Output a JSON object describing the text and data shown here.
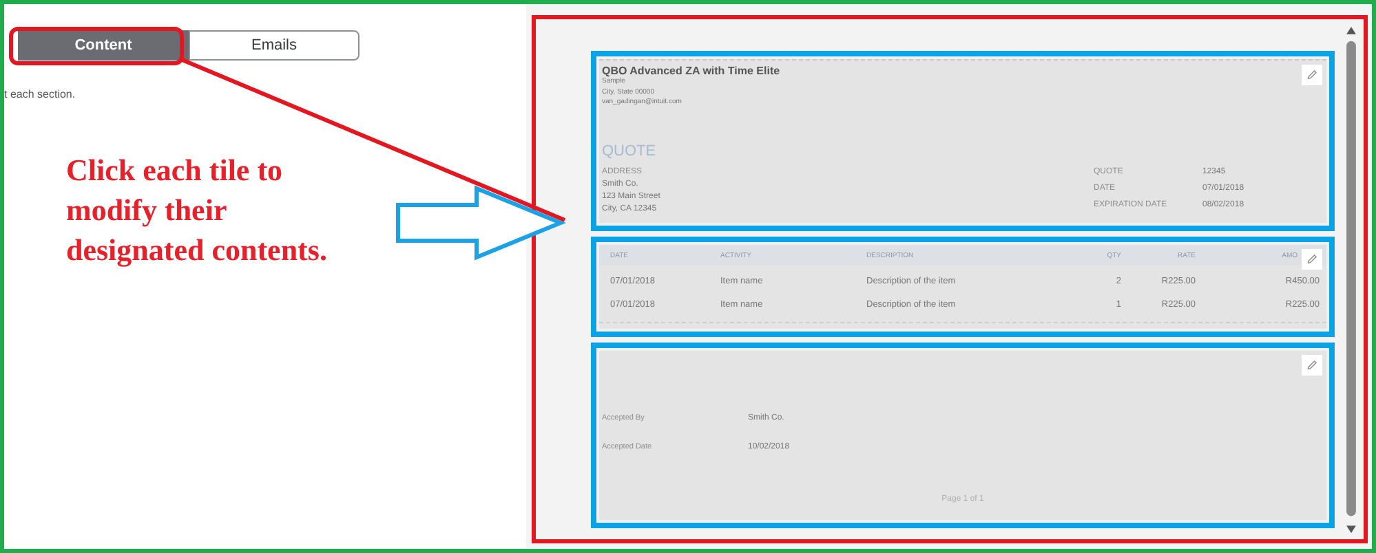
{
  "tabs": [
    {
      "label": "Content",
      "selected": true
    },
    {
      "label": "Emails",
      "selected": false
    }
  ],
  "hint": "t each section.",
  "annotation": "Click each tile to modify their designated contents.",
  "preview": {
    "header_tile": {
      "company": "QBO Advanced ZA with Time Elite",
      "address_lines": [
        "Sample",
        "City, State 00000",
        "van_gadingan@intuit.com"
      ],
      "doc_title": "QUOTE",
      "bill_to": {
        "label": "ADDRESS",
        "lines": [
          "Smith Co.",
          "123 Main Street",
          "City, CA 12345"
        ]
      },
      "meta": [
        {
          "label": "QUOTE",
          "value": "12345"
        },
        {
          "label": "DATE",
          "value": "07/01/2018"
        },
        {
          "label": "EXPIRATION DATE",
          "value": "08/02/2018"
        }
      ]
    },
    "items_tile": {
      "columns": [
        "DATE",
        "ACTIVITY",
        "DESCRIPTION",
        "QTY",
        "RATE",
        "AMO"
      ],
      "rows": [
        [
          "07/01/2018",
          "Item name",
          "Description of the item",
          "2",
          "R225.00",
          "R450.00"
        ],
        [
          "07/01/2018",
          "Item name",
          "Description of the item",
          "1",
          "R225.00",
          "R225.00"
        ]
      ]
    },
    "footer_tile": {
      "fields": [
        {
          "label": "Accepted By",
          "value": "Smith Co."
        },
        {
          "label": "Accepted Date",
          "value": "10/02/2018"
        }
      ],
      "page": "Page 1 of 1"
    }
  }
}
